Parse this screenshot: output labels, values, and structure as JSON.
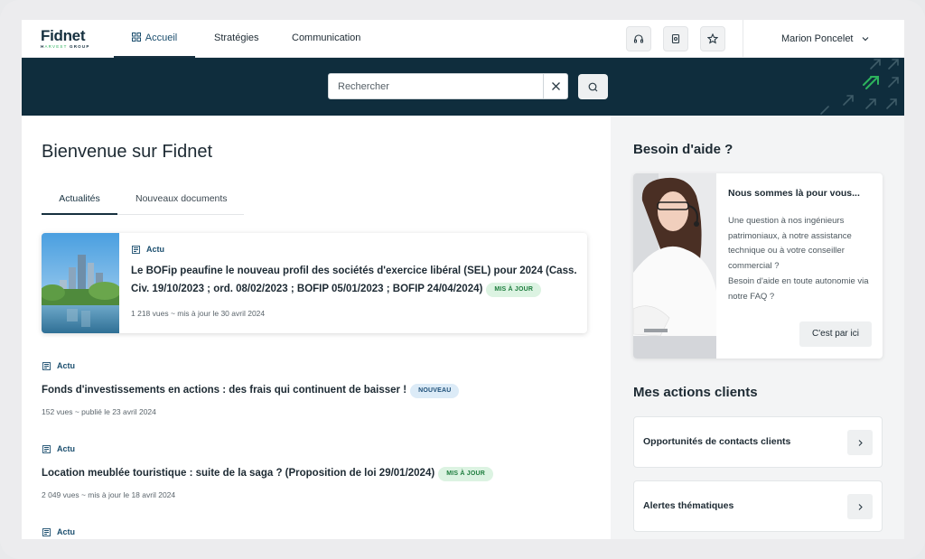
{
  "brand": {
    "name": "Fidnet",
    "sub_prefix": "H",
    "sub_accent": "ARVEST",
    "sub_suffix": " GROUP"
  },
  "nav": {
    "home": "Accueil",
    "strategies": "Stratégies",
    "communication": "Communication"
  },
  "header_icons": [
    "headset-icon",
    "document-icon",
    "star-icon"
  ],
  "user": {
    "name": "Marion Poncelet"
  },
  "search": {
    "placeholder": "Rechercher",
    "value": ""
  },
  "main": {
    "title": "Bienvenue sur Fidnet",
    "tabs": [
      {
        "label": "Actualités",
        "active": true
      },
      {
        "label": "Nouveaux documents",
        "active": false
      }
    ],
    "featured": {
      "category": "Actu",
      "title": "Le BOFip peaufine le nouveau profil des sociétés d'exercice libéral (SEL) pour 2024 (Cass. Civ. 19/10/2023 ; ord. 08/02/2023 ; BOFIP 05/01/2023 ; BOFIP 24/04/2024)",
      "badge": "MIS À JOUR",
      "meta": "1 218 vues ~ mis à jour le 30 avril 2024"
    },
    "articles": [
      {
        "category": "Actu",
        "title": "Fonds d'investissements en actions : des frais qui continuent de baisser !",
        "badge": "NOUVEAU",
        "meta": "152 vues ~ publié le 23 avril 2024"
      },
      {
        "category": "Actu",
        "title": "Location meublée touristique : suite de la saga ? (Proposition de loi 29/01/2024)",
        "badge": "MIS À JOUR",
        "meta": "2 049 vues ~ mis à jour le 18 avril 2024"
      },
      {
        "category": "Actu"
      }
    ]
  },
  "side": {
    "help_heading": "Besoin d'aide ?",
    "help_card": {
      "title": "Nous sommes là pour vous...",
      "text1": "Une question à nos ingénieurs patrimoniaux, à notre assistance technique ou à votre conseiller commercial ?",
      "text2": "Besoin d'aide en toute autonomie via notre FAQ ?",
      "button": "C'est par ici"
    },
    "actions_heading": "Mes actions clients",
    "actions": [
      {
        "label": "Opportunités de contacts clients"
      },
      {
        "label": "Alertes thématiques"
      }
    ]
  },
  "colors": {
    "navy": "#0f2d3d",
    "accent_green": "#2db35d",
    "badge_update_bg": "#dcf3e2",
    "badge_new_bg": "#dcebf7"
  }
}
